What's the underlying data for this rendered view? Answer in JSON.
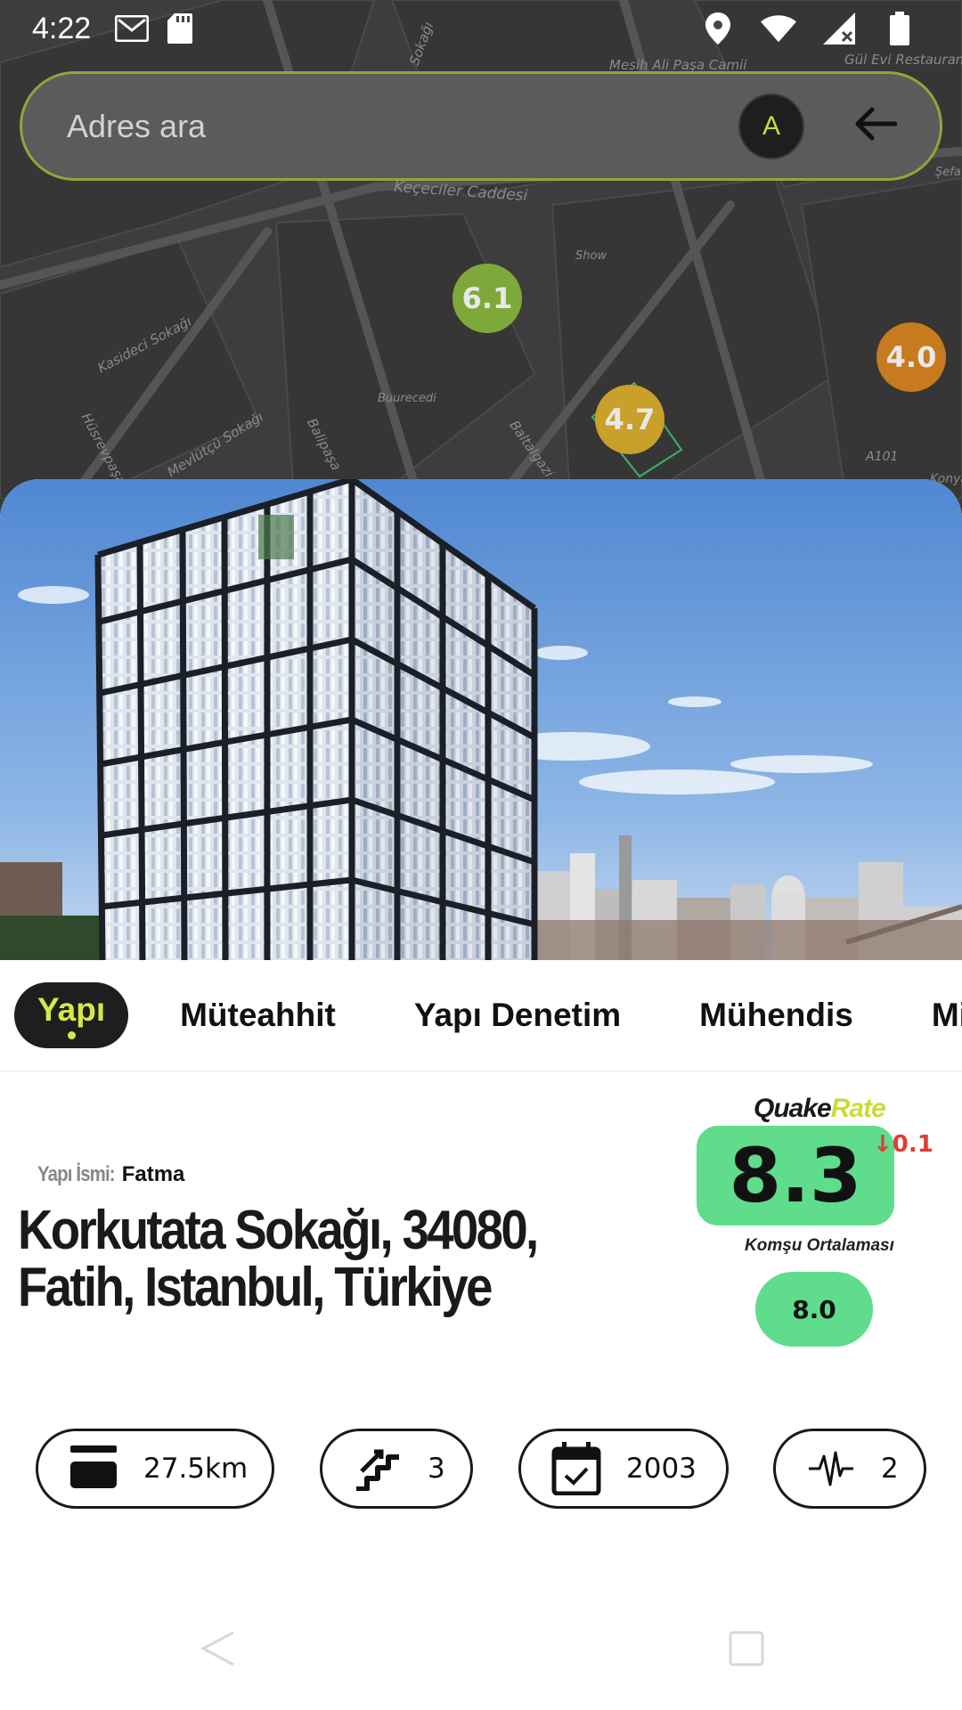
{
  "status_bar": {
    "time": "4:22",
    "left_icons": [
      "gmail-icon",
      "sd-card-icon"
    ],
    "right_icons": [
      "location-icon",
      "wifi-icon",
      "signal-icon",
      "battery-icon"
    ]
  },
  "search": {
    "placeholder": "Adres ara",
    "avatar_letter": "A"
  },
  "map": {
    "streets": [
      "Gül Evi Restaurant",
      "Mesih Ali Paşa Camii",
      "Keçeciler Caddesi",
      "Kasideci Sokağı",
      "Mevlütçü Sokağı",
      "Balipaşa",
      "Baltalgazi",
      "Hüsrevpaşa",
      "Buurecedi",
      "Show",
      "A101",
      "Konya",
      "Sokağı",
      "Şefa"
    ],
    "pins": [
      {
        "value": "6.1",
        "color": "#7fa83a"
      },
      {
        "value": "4.7",
        "color": "#c9a02a"
      },
      {
        "value": "4.0",
        "color": "#c77a1e"
      }
    ]
  },
  "tabs": [
    "Yapı",
    "Müteahhit",
    "Yapı Denetim",
    "Mühendis",
    "Mimar"
  ],
  "building": {
    "name_label": "Yapı İsmi:",
    "name": "Fatma",
    "address_line1": "Korkutata Sokağı, 34080,",
    "address_line2": "Fatih, Istanbul, Türkiye"
  },
  "rating": {
    "brand_quake": "Quake",
    "brand_rate": "Rate",
    "score": "8.3",
    "delta": "↓0.1",
    "neighbor_label": "Komşu Ortalaması",
    "neighbor_score": "8.0",
    "score_color": "#5fdc8c"
  },
  "stats": [
    {
      "icon": "distance-icon",
      "value": "27.5km"
    },
    {
      "icon": "stairs-icon",
      "value": "3"
    },
    {
      "icon": "calendar-icon",
      "value": "2003"
    },
    {
      "icon": "pulse-icon",
      "value": "2"
    }
  ],
  "colors": {
    "accent": "#d4e84a",
    "dark": "#1e1e1e"
  }
}
